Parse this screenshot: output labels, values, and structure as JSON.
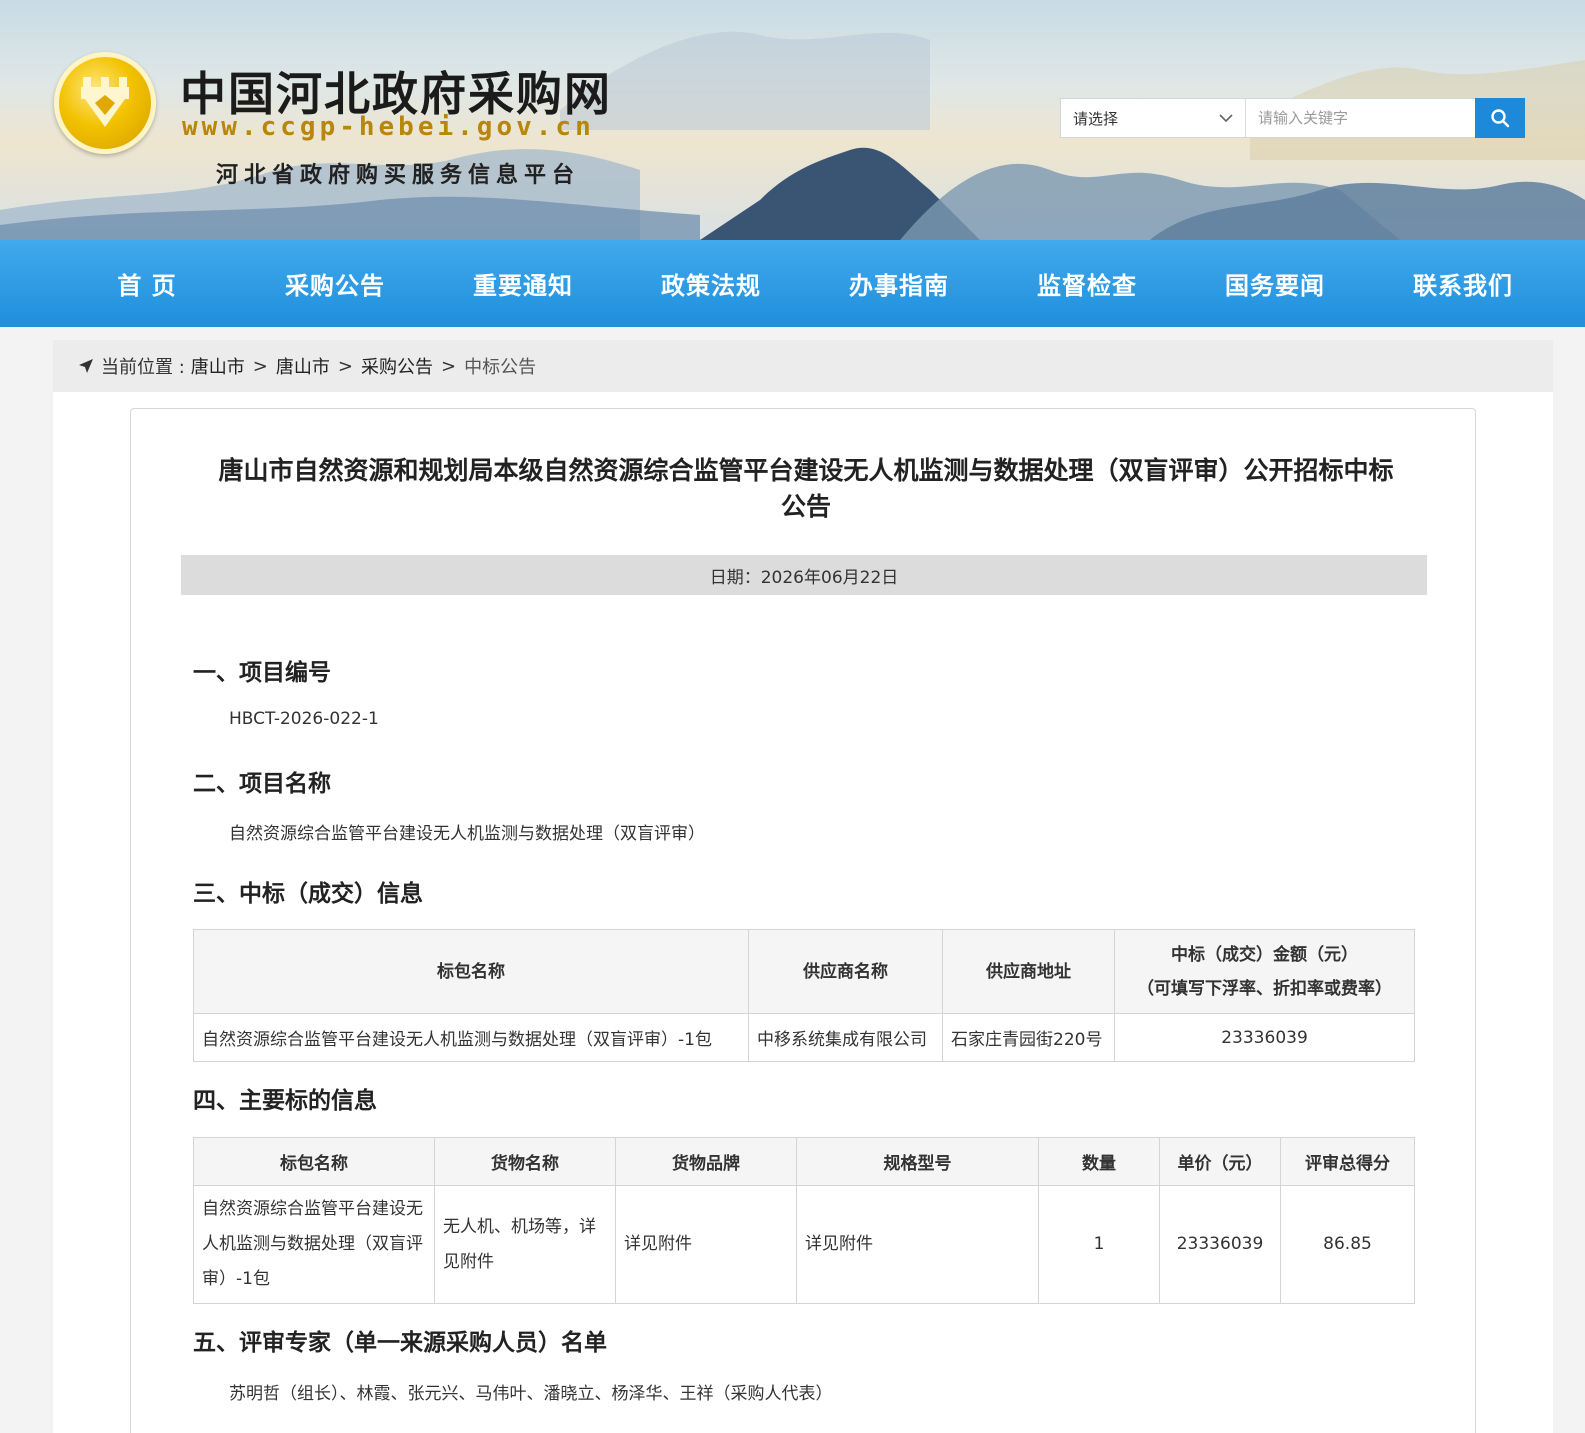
{
  "header": {
    "site_title": "中国河北政府采购网",
    "site_url": "www.ccgp-hebei.gov.cn",
    "site_subtitle": "河北省政府购买服务信息平台"
  },
  "search": {
    "select_value": "请选择",
    "placeholder": "请输入关键字",
    "input_value": ""
  },
  "nav": {
    "items": [
      "首 页",
      "采购公告",
      "重要通知",
      "政策法规",
      "办事指南",
      "监督检查",
      "国务要闻",
      "联系我们"
    ]
  },
  "breadcrumb": {
    "prefix": "当前位置 :",
    "items": [
      "唐山市",
      "唐山市",
      "采购公告",
      "中标公告"
    ],
    "separator": ">"
  },
  "article": {
    "title": "唐山市自然资源和规划局本级自然资源综合监管平台建设无人机监测与数据处理（双盲评审）公开招标中标公告",
    "date": "日期：2026年06月22日",
    "sections": [
      {
        "heading": "一、项目编号",
        "text": "HBCT-2026-022-1"
      },
      {
        "heading": "二、项目名称",
        "text": "自然资源综合监管平台建设无人机监测与数据处理（双盲评审）"
      },
      {
        "heading": "三、中标（成交）信息"
      },
      {
        "heading": "四、主要标的信息"
      },
      {
        "heading": "五、评审专家（单一来源采购人员）名单",
        "text": "苏明哲（组长）、林霞、张元兴、马伟叶、潘晓立、杨泽华、王祥（采购人代表）"
      }
    ]
  },
  "award_table": {
    "headers": [
      "标包名称",
      "供应商名称",
      "供应商地址",
      "中标（成交）金额（元）",
      "（可填写下浮率、折扣率或费率）"
    ],
    "rows": [
      [
        "自然资源综合监管平台建设无人机监测与数据处理（双盲评审）-1包",
        "中移系统集成有限公司",
        "石家庄青园街220号",
        "23336039"
      ]
    ]
  },
  "items_table": {
    "headers": [
      "标包名称",
      "货物名称",
      "货物品牌",
      "规格型号",
      "数量",
      "单价（元）",
      "评审总得分"
    ],
    "rows": [
      [
        "自然资源综合监管平台建设无人机监测与数据处理（双盲评审）-1包",
        "无人机、机场等，详见附件",
        "详见附件",
        "详见附件",
        "1",
        "23336039",
        "86.85"
      ]
    ]
  },
  "colors": {
    "nav_bg": "#2a97e0",
    "search_button": "#1e88d9",
    "logo_gold": "#f2c200"
  }
}
